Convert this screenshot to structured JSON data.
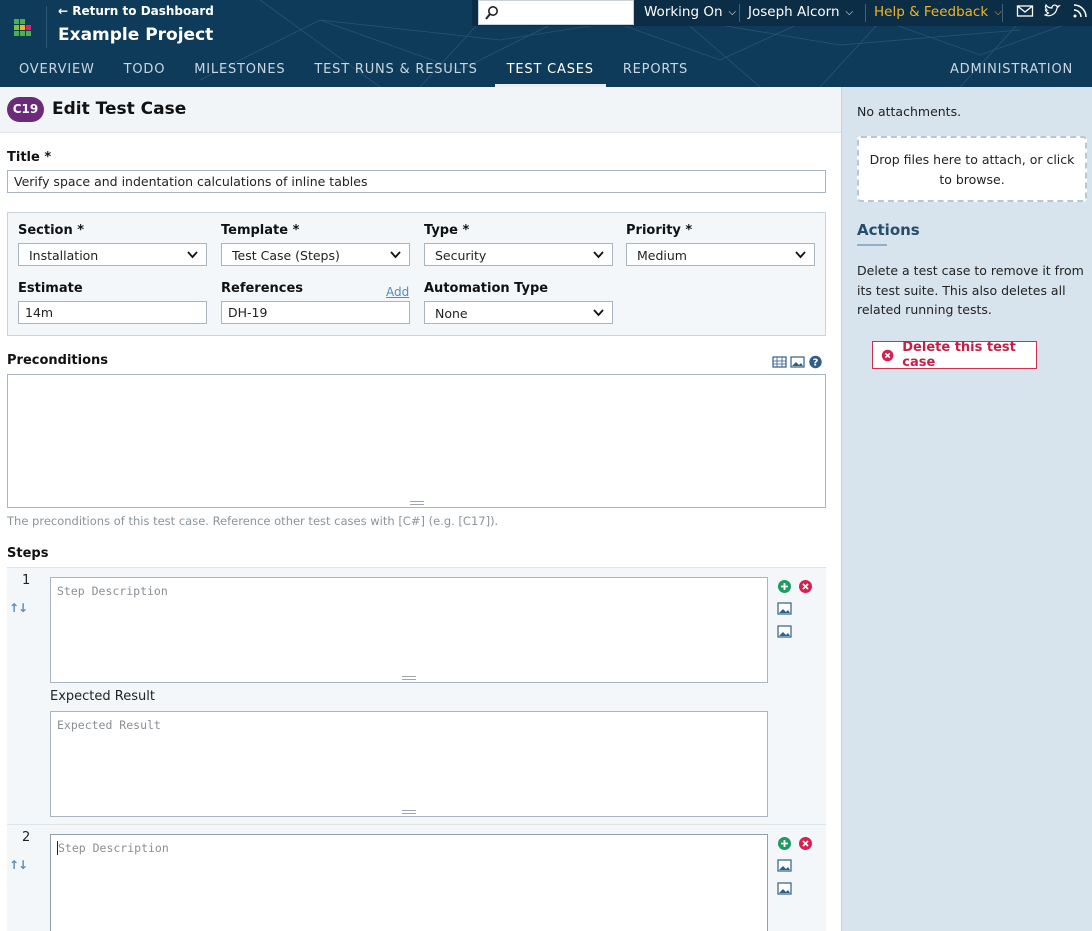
{
  "header": {
    "return_link": "← Return to Dashboard",
    "project_name": "Example Project",
    "search_placeholder": "",
    "working_on": "Working On",
    "user": "Joseph Alcorn",
    "help": "Help & Feedback",
    "colors": {
      "header_bg": "#0f3b5a",
      "help_accent": "#f0b429"
    },
    "icons": [
      "search-icon",
      "mail-icon",
      "twitter-icon",
      "rss-icon"
    ]
  },
  "nav": {
    "items": [
      "OVERVIEW",
      "TODO",
      "MILESTONES",
      "TEST RUNS & RESULTS",
      "TEST CASES",
      "REPORTS"
    ],
    "active": "TEST CASES",
    "admin": "ADMINISTRATION"
  },
  "page": {
    "badge": "C19",
    "title": "Edit Test Case"
  },
  "form": {
    "title_label": "Title *",
    "title_value": "Verify space and indentation calculations of inline tables",
    "section_label": "Section *",
    "section_value": "Installation",
    "template_label": "Template *",
    "template_value": "Test Case (Steps)",
    "type_label": "Type *",
    "type_value": "Security",
    "priority_label": "Priority *",
    "priority_value": "Medium",
    "estimate_label": "Estimate",
    "estimate_value": "14m",
    "references_label": "References",
    "references_add": "Add",
    "references_value": "DH-19",
    "automation_label": "Automation Type",
    "automation_value": "None",
    "preconditions_label": "Preconditions",
    "preconditions_hint": "The preconditions of this test case. Reference other test cases with [C#] (e.g. [C17]).",
    "steps_label": "Steps",
    "steps": [
      {
        "number": "1",
        "arrows": "↑↓",
        "description_placeholder": "Step Description",
        "expected_label": "Expected Result",
        "expected_placeholder": "Expected Result"
      },
      {
        "number": "2",
        "arrows": "↑↓",
        "description_placeholder": "Step Description"
      }
    ]
  },
  "sidebar": {
    "no_attachments": "No attachments.",
    "dropzone": "Drop files here to attach, or click to browse.",
    "actions_title": "Actions",
    "actions_text": "Delete a test case to remove it from its test suite. This also deletes all related running tests.",
    "delete_button": "Delete this test case",
    "colors": {
      "sidebar_bg": "#d7e4ed",
      "delete": "#c51f48"
    }
  }
}
